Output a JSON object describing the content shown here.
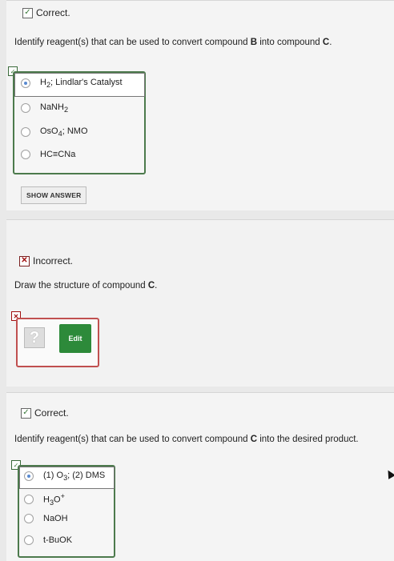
{
  "q1": {
    "status": "Correct.",
    "question_prefix": "Identify reagent(s) that can be used to convert compound ",
    "question_b": "B",
    "question_mid": " into compound ",
    "question_c": "C",
    "question_end": ".",
    "options": [
      {
        "pre": "H",
        "sub": "2",
        "post": "; Lindlar's Catalyst",
        "selected": true
      },
      {
        "pre": "NaNH",
        "sub": "2",
        "post": "",
        "selected": false
      },
      {
        "pre": "OsO",
        "sub": "4",
        "post": "; NMO",
        "selected": false
      },
      {
        "pre": "HC≡CNa",
        "sub": "",
        "post": "",
        "selected": false
      }
    ],
    "show_answer": "SHOW ANSWER"
  },
  "q2": {
    "status": "Incorrect.",
    "question_prefix": "Draw the structure of compound ",
    "question_c": "C",
    "question_end": ".",
    "edit_label": "Edit",
    "placeholder": "?"
  },
  "q3": {
    "status": "Correct.",
    "question_prefix": "Identify reagent(s) that can be used to convert compound ",
    "question_c": "C",
    "question_end": " into the desired product.",
    "options": [
      {
        "pre": "(1) O",
        "sub": "3",
        "post": "; (2) DMS",
        "selected": true
      },
      {
        "pre": "H",
        "sub": "3",
        "post": "O",
        "sup": "+",
        "selected": false
      },
      {
        "pre": "NaOH",
        "sub": "",
        "post": "",
        "selected": false
      },
      {
        "pre": "t-BuOK",
        "sub": "",
        "post": "",
        "selected": false
      }
    ]
  },
  "colors": {
    "correct": "#4c7a4c",
    "incorrect": "#c05050",
    "edit": "#2d8a3a"
  },
  "icons": [
    "checkmark-icon",
    "x-mark-icon",
    "radio-icon",
    "question-mark-icon",
    "cursor-icon"
  ]
}
